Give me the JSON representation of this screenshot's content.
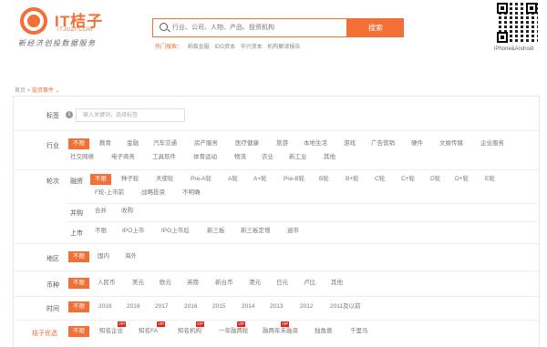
{
  "header": {
    "logo_title": "IT桔子",
    "logo_sub": "ITJUZI.COM",
    "slogan": "新经济创投数据服务",
    "search_placeholder": "行业、公司、人物、产品、投资机构",
    "search_button": "搜索",
    "hot_label": "热门搜索：",
    "hot_links": [
      "蚂蚁金服",
      "IDG资本",
      "华兴资本",
      "机构解读报告"
    ],
    "qr_caption": "iPhone&Android"
  },
  "breadcrumb": {
    "home": "首页",
    "sep": ">",
    "current": "投资事件",
    "caret": "⌄"
  },
  "filters": {
    "tag": {
      "label": "标签",
      "placeholder": "输入关键词，选择标签"
    },
    "industry": {
      "label": "行业",
      "options_line1": [
        "不限",
        "教育",
        "金融",
        "汽车交通",
        "房产服务",
        "医疗健康",
        "旅游",
        "本地生活",
        "游戏",
        "广告营销",
        "硬件",
        "文娱传媒",
        "企业服务"
      ],
      "options_line2": [
        "社交网络",
        "电子商务",
        "工具软件",
        "体育运动",
        "物流",
        "农业",
        "新工业",
        "其他"
      ]
    },
    "round": {
      "label": "轮次",
      "financing_label": "融资",
      "financing_line1": [
        "不限",
        "种子轮",
        "天使轮",
        "Pre-A轮",
        "A轮",
        "A+轮",
        "Pre-B轮",
        "B轮",
        "B+轮",
        "C轮",
        "C+轮",
        "D轮",
        "D+轮",
        "E轮"
      ],
      "financing_line2": [
        "F轮-上市前",
        "战略投资",
        "不明确"
      ],
      "merger_label": "并购",
      "merger_options": [
        "合并",
        "收购"
      ],
      "listing_label": "上市",
      "listing_options": [
        "不限",
        "IPO上市",
        "IPO上市后",
        "新三板",
        "新三板定增",
        "退市"
      ]
    },
    "region": {
      "label": "地区",
      "options": [
        "不限",
        "国内",
        "海外"
      ]
    },
    "currency": {
      "label": "币种",
      "options": [
        "不限",
        "人民币",
        "美元",
        "欧元",
        "英镑",
        "新台币",
        "港元",
        "日元",
        "卢比",
        "其他"
      ]
    },
    "time": {
      "label": "时间",
      "options": [
        "不限",
        "2019",
        "2018",
        "2017",
        "2016",
        "2015",
        "2014",
        "2013",
        "2012",
        "2011及以前"
      ]
    },
    "juzi": {
      "label": "桔子优选",
      "options": [
        "不限",
        "知名企业",
        "知名FA",
        "知名机构",
        "一年融两轮",
        "融两年未融资",
        "独角兽",
        "千里马"
      ],
      "vip_badge": "VIP"
    }
  }
}
